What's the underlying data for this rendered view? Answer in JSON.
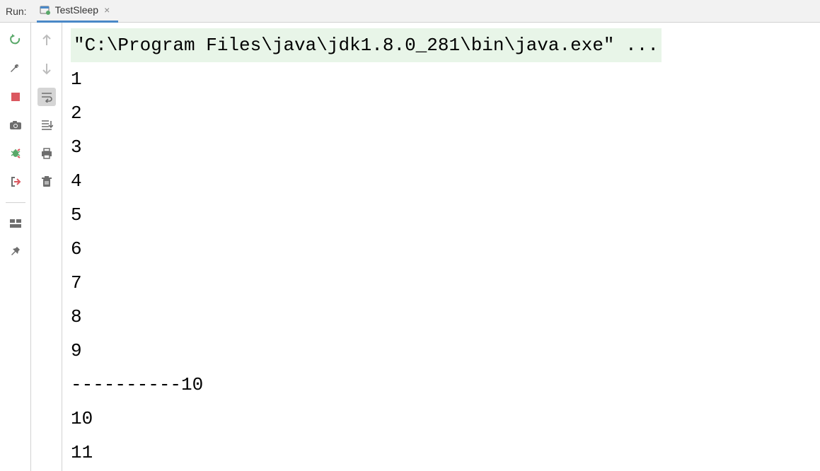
{
  "header": {
    "run_label": "Run:",
    "tab_title": "TestSleep",
    "tab_close": "×"
  },
  "console": {
    "command": "\"C:\\Program Files\\java\\jdk1.8.0_281\\bin\\java.exe\" ...",
    "lines": [
      "1",
      "2",
      "3",
      "4",
      "5",
      "6",
      "7",
      "8",
      "9",
      "----------10",
      "10",
      "11"
    ]
  }
}
